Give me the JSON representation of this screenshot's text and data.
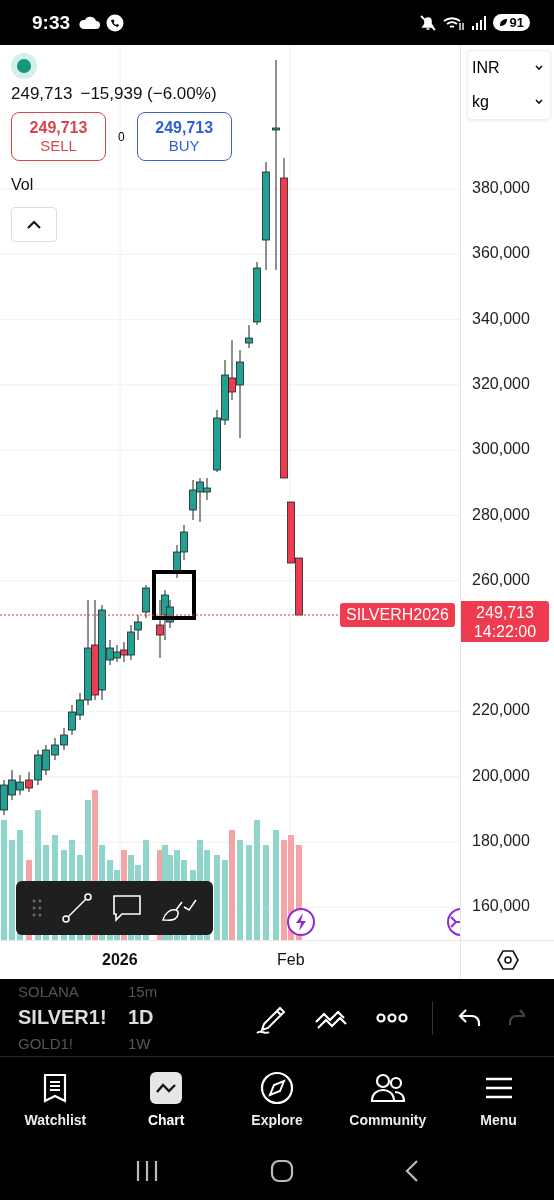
{
  "status_bar": {
    "time": "9:33",
    "battery": "91"
  },
  "quote": {
    "price": "249,713",
    "change": "−15,939 (−6.00%)"
  },
  "sell": {
    "price": "249,713",
    "label": "SELL"
  },
  "spread": "0",
  "buy": {
    "price": "249,713",
    "label": "BUY"
  },
  "volume_label": "Vol",
  "currency_select": "INR",
  "unit_select": "kg",
  "price_axis": [
    "380,000",
    "360,000",
    "340,000",
    "320,000",
    "300,000",
    "280,000",
    "260,000",
    "220,000",
    "200,000",
    "180,000",
    "160,000"
  ],
  "last_price": {
    "symbol": "SILVERH2026",
    "price": "249,713",
    "countdown": "14:22:00"
  },
  "time_axis": [
    {
      "label": "2026",
      "kind": "year"
    },
    {
      "label": "Feb",
      "kind": "month"
    }
  ],
  "symbol_picker": [
    {
      "symbol": "SOLANA",
      "interval": "15m",
      "selected": false
    },
    {
      "symbol": "SILVER1!",
      "interval": "1D",
      "selected": true
    },
    {
      "symbol": "GOLD1!",
      "interval": "1W",
      "selected": false
    }
  ],
  "nav": [
    {
      "label": "Watchlist",
      "kind": "watchlist",
      "selected": false
    },
    {
      "label": "Chart",
      "kind": "chart",
      "selected": true
    },
    {
      "label": "Explore",
      "kind": "explore",
      "selected": false
    },
    {
      "label": "Community",
      "kind": "community",
      "selected": false
    },
    {
      "label": "Menu",
      "kind": "menu",
      "selected": false
    }
  ]
}
